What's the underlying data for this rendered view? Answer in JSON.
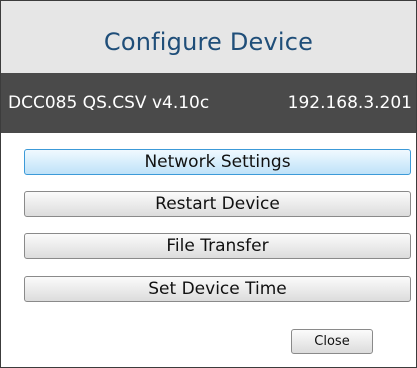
{
  "dialog": {
    "title": "Configure Device"
  },
  "device": {
    "name": "DCC085 QS.CSV v4.10c",
    "ip": "192.168.3.201"
  },
  "actions": [
    {
      "label": "Network Settings",
      "active": true
    },
    {
      "label": "Restart Device",
      "active": false
    },
    {
      "label": "File Transfer",
      "active": false
    },
    {
      "label": "Set Device Time",
      "active": false
    }
  ],
  "footer": {
    "close_label": "Close"
  },
  "colors": {
    "title": "#1f4e79",
    "infobar_bg": "#4a4a4a",
    "active_button": "#bfe2f8"
  }
}
